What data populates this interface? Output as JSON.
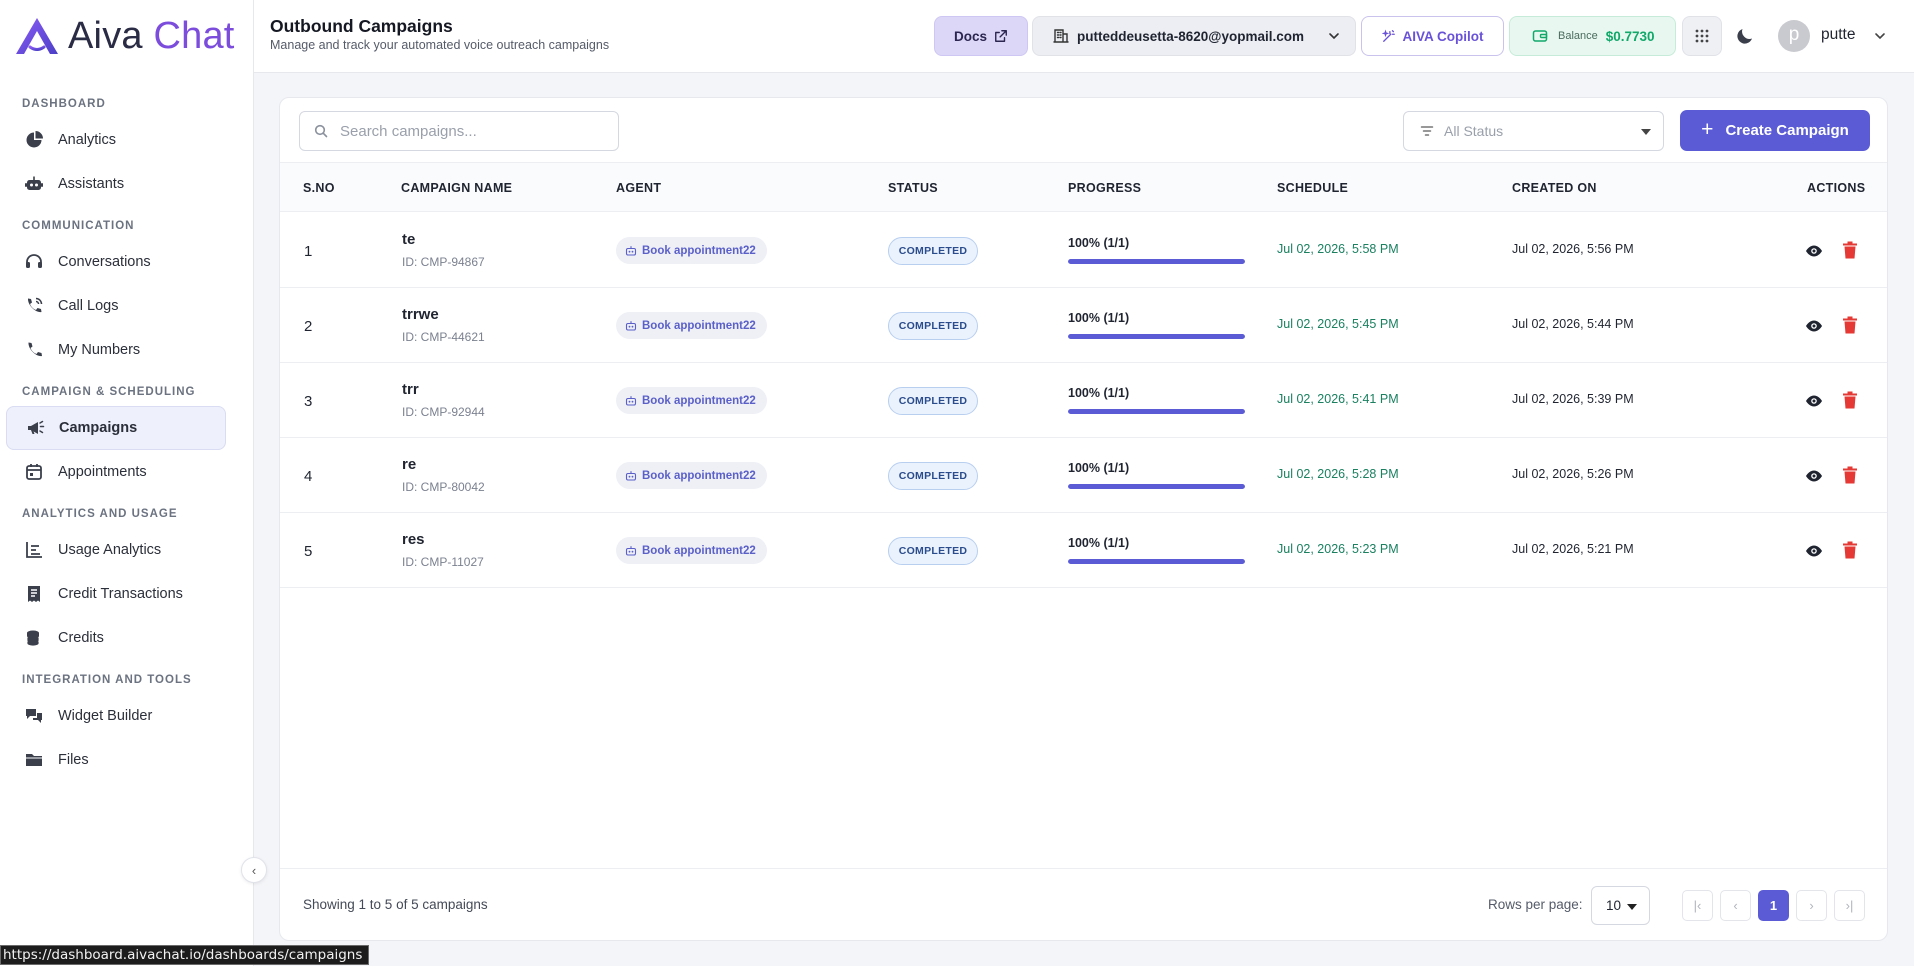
{
  "app": {
    "logo_word1": "Aiva",
    "logo_word2": "Chat"
  },
  "sidebar": {
    "sections": [
      {
        "title": "DASHBOARD",
        "items": [
          {
            "label": "Analytics",
            "icon": "pie-chart-icon"
          },
          {
            "label": "Assistants",
            "icon": "robot-icon"
          }
        ]
      },
      {
        "title": "COMMUNICATION",
        "items": [
          {
            "label": "Conversations",
            "icon": "headset-icon"
          },
          {
            "label": "Call Logs",
            "icon": "phone-call-icon"
          },
          {
            "label": "My Numbers",
            "icon": "phone-icon"
          }
        ]
      },
      {
        "title": "CAMPAIGN & SCHEDULING",
        "items": [
          {
            "label": "Campaigns",
            "icon": "megaphone-icon",
            "active": true
          },
          {
            "label": "Appointments",
            "icon": "calendar-icon"
          }
        ]
      },
      {
        "title": "ANALYTICS AND USAGE",
        "items": [
          {
            "label": "Usage Analytics",
            "icon": "bar-chart-icon"
          },
          {
            "label": "Credit Transactions",
            "icon": "receipt-icon"
          },
          {
            "label": "Credits",
            "icon": "coins-icon"
          }
        ]
      },
      {
        "title": "INTEGRATION AND TOOLS",
        "items": [
          {
            "label": "Widget Builder",
            "icon": "chat-bubbles-icon"
          },
          {
            "label": "Files",
            "icon": "folder-icon"
          }
        ]
      }
    ],
    "collapse_glyph": "‹"
  },
  "header": {
    "title": "Outbound Campaigns",
    "subtitle": "Manage and track your automated voice outreach campaigns",
    "docs_label": "Docs",
    "account_email": "putteddeusetta-8620@yopmail.com",
    "copilot_label": "AIVA Copilot",
    "balance_label": "Balance",
    "balance_value": "$0.7730",
    "avatar_initial": "p",
    "user_name": "putte"
  },
  "toolbar": {
    "search_placeholder": "Search campaigns...",
    "status_filter": "All Status",
    "create_label": "Create Campaign",
    "create_glyph": "+"
  },
  "table": {
    "headers": {
      "sno": "S.NO",
      "name": "CAMPAIGN NAME",
      "agent": "AGENT",
      "status": "STATUS",
      "progress": "PROGRESS",
      "schedule": "SCHEDULE",
      "created": "CREATED ON",
      "actions": "ACTIONS"
    },
    "rows": [
      {
        "sno": "1",
        "name": "te",
        "id": "ID: CMP-94867",
        "agent": "Book appointment22",
        "status": "COMPLETED",
        "progress_text": "100% (1/1)",
        "progress": 1.0,
        "schedule": "Jul 02, 2026, 5:58 PM",
        "created": "Jul 02, 2026, 5:56 PM"
      },
      {
        "sno": "2",
        "name": "trrwe",
        "id": "ID: CMP-44621",
        "agent": "Book appointment22",
        "status": "COMPLETED",
        "progress_text": "100% (1/1)",
        "progress": 1.0,
        "schedule": "Jul 02, 2026, 5:45 PM",
        "created": "Jul 02, 2026, 5:44 PM"
      },
      {
        "sno": "3",
        "name": "trr",
        "id": "ID: CMP-92944",
        "agent": "Book appointment22",
        "status": "COMPLETED",
        "progress_text": "100% (1/1)",
        "progress": 1.0,
        "schedule": "Jul 02, 2026, 5:41 PM",
        "created": "Jul 02, 2026, 5:39 PM"
      },
      {
        "sno": "4",
        "name": "re",
        "id": "ID: CMP-80042",
        "agent": "Book appointment22",
        "status": "COMPLETED",
        "progress_text": "100% (1/1)",
        "progress": 1.0,
        "schedule": "Jul 02, 2026, 5:28 PM",
        "created": "Jul 02, 2026, 5:26 PM"
      },
      {
        "sno": "5",
        "name": "res",
        "id": "ID: CMP-11027",
        "agent": "Book appointment22",
        "status": "COMPLETED",
        "progress_text": "100% (1/1)",
        "progress": 1.0,
        "schedule": "Jul 02, 2026, 5:23 PM",
        "created": "Jul 02, 2026, 5:21 PM"
      }
    ]
  },
  "footer": {
    "showing": "Showing 1 to 5 of 5 campaigns",
    "rows_per_page_label": "Rows per page:",
    "rows_per_page": "10",
    "pages": [
      "1"
    ],
    "current_page": "1",
    "first_glyph": "|‹",
    "prev_glyph": "‹",
    "next_glyph": "›",
    "last_glyph": "›|"
  },
  "status_bar_url": "https://dashboard.aivachat.io/dashboards/campaigns",
  "colors": {
    "accent": "#5b5bd6",
    "brand_purple": "#7c4ddc",
    "schedule_green": "#1a8060",
    "balance_green": "#11a86a",
    "delete_red": "#e53935"
  }
}
